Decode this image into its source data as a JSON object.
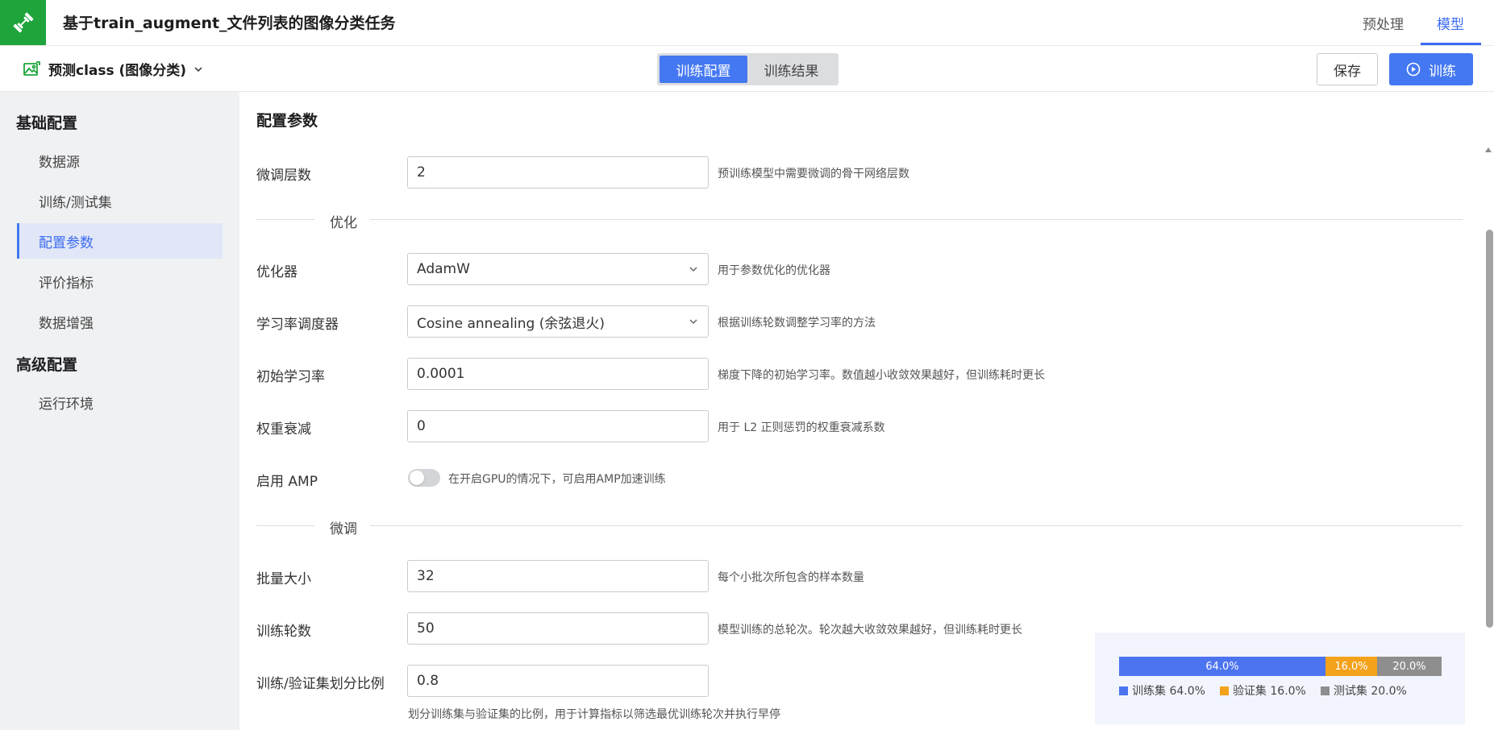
{
  "header": {
    "title": "基于train_augment_文件列表的图像分类任务",
    "tabs": [
      {
        "label": "预处理",
        "active": false
      },
      {
        "label": "模型",
        "active": true
      }
    ],
    "accent_color": "#4478f2",
    "logo_color": "#1fa43b"
  },
  "subbar": {
    "task_select": "预测class (图像分类)",
    "segments": [
      {
        "label": "训练配置",
        "active": true
      },
      {
        "label": "训练结果",
        "active": false
      }
    ],
    "save_label": "保存",
    "train_label": "训练"
  },
  "sidebar": {
    "groups": [
      {
        "title": "基础配置",
        "items": [
          {
            "label": "数据源"
          },
          {
            "label": "训练/测试集"
          },
          {
            "label": "配置参数",
            "active": true
          },
          {
            "label": "评价指标"
          },
          {
            "label": "数据增强"
          }
        ]
      },
      {
        "title": "高级配置",
        "items": [
          {
            "label": "运行环境"
          }
        ]
      }
    ]
  },
  "main": {
    "section_title": "配置参数",
    "finetune_layers": {
      "label": "微调层数",
      "value": "2",
      "hint": "预训练模型中需要微调的骨干网络层数"
    },
    "divider_optimize": "优化",
    "optimizer": {
      "label": "优化器",
      "value": "AdamW",
      "hint": "用于参数优化的优化器"
    },
    "scheduler": {
      "label": "学习率调度器",
      "value": "Cosine annealing (余弦退火)",
      "hint": "根据训练轮数调整学习率的方法"
    },
    "lr": {
      "label": "初始学习率",
      "value": "0.0001",
      "hint": "梯度下降的初始学习率。数值越小收敛效果越好，但训练耗时更长"
    },
    "weight_decay": {
      "label": "权重衰减",
      "value": "0",
      "hint": "用于 L2 正则惩罚的权重衰减系数"
    },
    "amp": {
      "label": "启用 AMP",
      "enabled": false,
      "hint": "在开启GPU的情况下，可启用AMP加速训练"
    },
    "divider_finetune": "微调",
    "batch_size": {
      "label": "批量大小",
      "value": "32",
      "hint": "每个小批次所包含的样本数量"
    },
    "epochs": {
      "label": "训练轮数",
      "value": "50",
      "hint": "模型训练的总轮次。轮次越大收敛效果越好，但训练耗时更长"
    },
    "split_ratio": {
      "label": "训练/验证集划分比例",
      "value": "0.8",
      "hint": "划分训练集与验证集的比例，用于计算指标以筛选最优训练轮次并执行早停"
    }
  },
  "split": {
    "segments": [
      {
        "name": "训练集",
        "percent": 64.0,
        "label": "64.0%",
        "legend": "训练集 64.0%",
        "color": "#4d74f0"
      },
      {
        "name": "验证集",
        "percent": 16.0,
        "label": "16.0%",
        "legend": "验证集 16.0%",
        "color": "#f4a21c"
      },
      {
        "name": "测试集",
        "percent": 20.0,
        "label": "20.0%",
        "legend": "测试集 20.0%",
        "color": "#8e8e8e"
      }
    ]
  }
}
